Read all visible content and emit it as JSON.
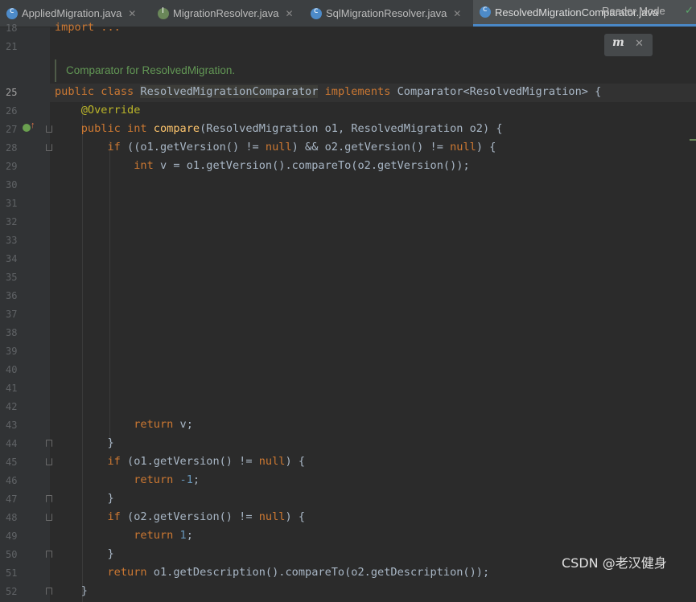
{
  "tabs": [
    {
      "label": "AppliedMigration.java",
      "icon": "class-icon"
    },
    {
      "label": "MigrationResolver.java",
      "icon": "interface-icon"
    },
    {
      "label": "SqlMigrationResolver.java",
      "icon": "class-icon"
    },
    {
      "label": "ResolvedMigrationComparator.java",
      "icon": "class-icon"
    }
  ],
  "editor": {
    "reader_mode": "Reader Mode",
    "doc_comment": "Comparator for ResolvedMigration.",
    "line_numbers": [
      "18",
      "21",
      "25",
      "26",
      "27",
      "28",
      "29",
      "30",
      "31",
      "32",
      "33",
      "34",
      "35",
      "36",
      "37",
      "38",
      "39",
      "40",
      "41",
      "42",
      "43",
      "44",
      "45",
      "46",
      "47",
      "48",
      "49",
      "50",
      "51",
      "52"
    ],
    "lines": {
      "l18": "import ...",
      "l43": "return v;",
      "l44": "}",
      "l47": "}",
      "l50": "}",
      "l52": "}"
    }
  },
  "watermark": "CSDN @老汉健身",
  "colors": {
    "keyword": "#cc7832",
    "function": "#ffc66d",
    "number": "#6897bb",
    "annotation": "#bbb529",
    "comment": "#629755"
  }
}
